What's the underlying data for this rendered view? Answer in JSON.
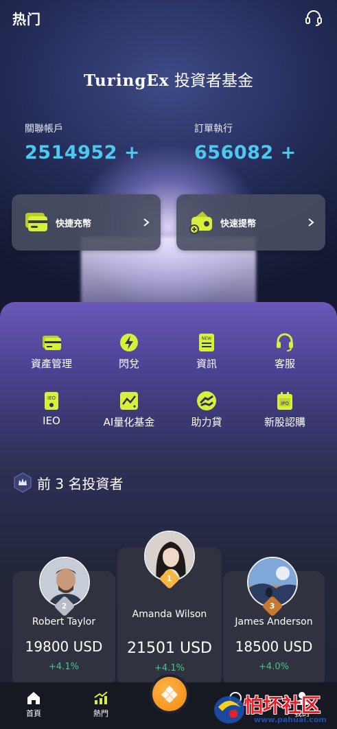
{
  "header": {
    "title": "热门"
  },
  "brand": {
    "name": "TuringEx",
    "suffix": " 投資者基金"
  },
  "stats": [
    {
      "label": "關聯帳戶",
      "value": "2514952 +"
    },
    {
      "label": "訂單執行",
      "value": "656082 +"
    }
  ],
  "quick_actions": [
    {
      "label": "快捷充幣"
    },
    {
      "label": "快速提幣"
    }
  ],
  "grid": [
    {
      "label": "資產管理",
      "icon": "wallet-icon"
    },
    {
      "label": "閃兌",
      "icon": "lightning-icon"
    },
    {
      "label": "資訊",
      "icon": "news-icon"
    },
    {
      "label": "客服",
      "icon": "headset-icon"
    },
    {
      "label": "IEO",
      "icon": "ieo-icon"
    },
    {
      "label": "AI量化基金",
      "icon": "chart-icon"
    },
    {
      "label": "助力貸",
      "icon": "handshake-icon"
    },
    {
      "label": "新股認購",
      "icon": "ipo-icon"
    }
  ],
  "top_investors": {
    "title": "前 3 名投資者",
    "items": [
      {
        "rank": "2",
        "name": "Robert Taylor",
        "amount": "19800 USD",
        "change": "+4.1%"
      },
      {
        "rank": "1",
        "name": "Amanda Wilson",
        "amount": "21501 USD",
        "change": "+4.1%"
      },
      {
        "rank": "3",
        "name": "James Anderson",
        "amount": "18500 USD",
        "change": "+4.0%"
      }
    ]
  },
  "nav": {
    "items": [
      {
        "label": "首頁"
      },
      {
        "label": "熱門"
      },
      {
        "label": "金"
      },
      {
        "label": "我的"
      }
    ]
  },
  "watermark": {
    "text": "怕坏社区",
    "url": "www.pahuai.com"
  },
  "colors": {
    "accent": "#4cc9f0",
    "lime": "#d7f03a",
    "positive": "#3ec98c",
    "gold": "#f5b642"
  }
}
